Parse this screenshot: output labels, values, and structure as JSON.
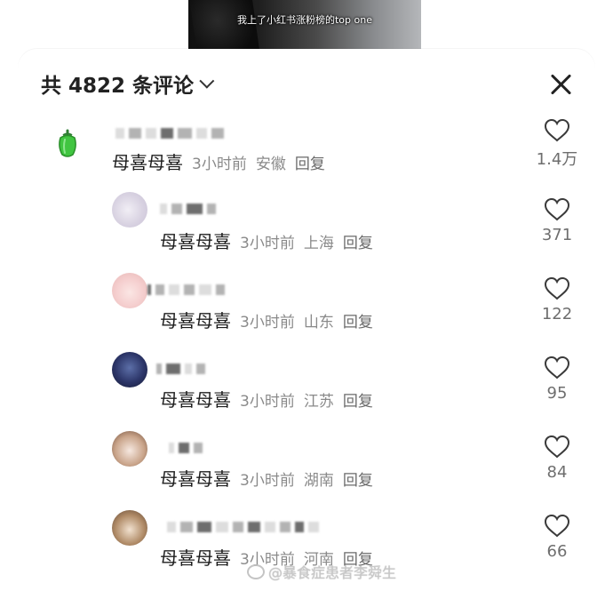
{
  "video": {
    "caption": "我上了小红书涨粉榜的top one"
  },
  "header": {
    "title": "共 4822 条评论"
  },
  "comments": [
    {
      "avatar": "green-pepper-avatar",
      "text": "母喜母喜",
      "time": "3小时前",
      "location": "安徽",
      "reply": "回复",
      "likes": "1.4万"
    },
    {
      "avatar": "lavender-avatar",
      "text": "母喜母喜",
      "time": "3小时前",
      "location": "上海",
      "reply": "回复",
      "likes": "371"
    },
    {
      "avatar": "pink-bunny-avatar",
      "text": "母喜母喜",
      "time": "3小时前",
      "location": "山东",
      "reply": "回复",
      "likes": "122"
    },
    {
      "avatar": "blue-anime-avatar",
      "text": "母喜母喜",
      "time": "3小时前",
      "location": "江苏",
      "reply": "回复",
      "likes": "95"
    },
    {
      "avatar": "brown-hair-avatar",
      "text": "母喜母喜",
      "time": "3小时前",
      "location": "湖南",
      "reply": "回复",
      "likes": "84"
    },
    {
      "avatar": "sepia-avatar",
      "text": "母喜母喜",
      "time": "3小时前",
      "location": "河南",
      "reply": "回复",
      "likes": "66"
    }
  ],
  "watermark": "@暴食症患者李舜生",
  "colors": {
    "heart_stroke": "#3a3a3a",
    "pepper_green": "#3fbf3f"
  }
}
